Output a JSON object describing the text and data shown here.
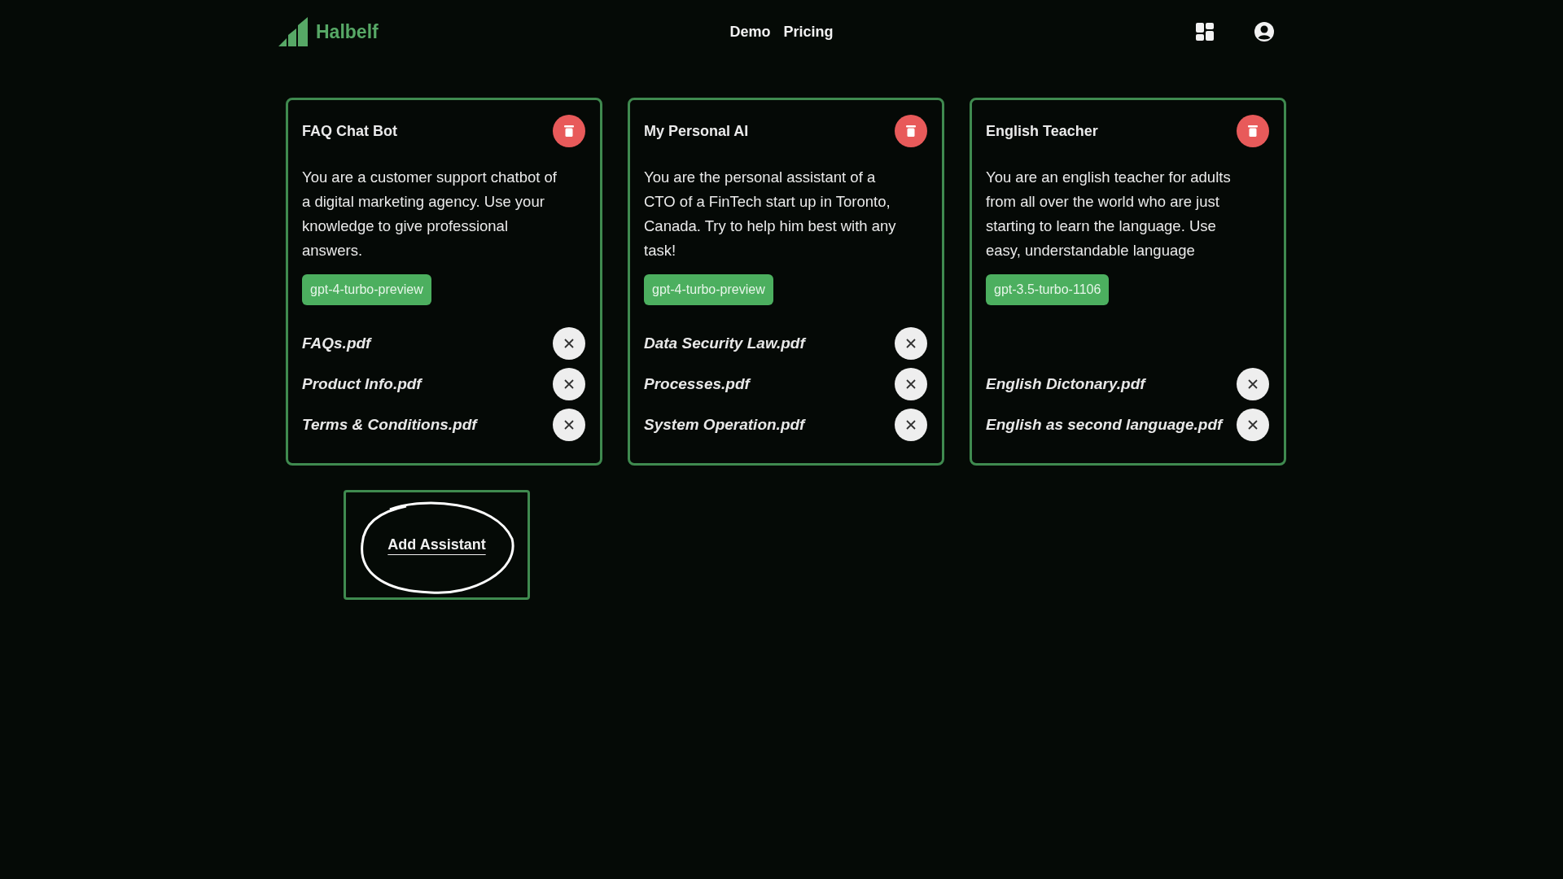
{
  "brand": {
    "name": "Halbelf"
  },
  "nav": [
    {
      "label": "Demo"
    },
    {
      "label": "Pricing"
    }
  ],
  "assistants": [
    {
      "title": "FAQ Chat Bot",
      "description": "You are a customer support chatbot of a digital marketing agency. Use your knowledge to give professional answers.",
      "model": "gpt-4-turbo-preview",
      "files": [
        "FAQs.pdf",
        "Product Info.pdf",
        "Terms & Conditions.pdf"
      ]
    },
    {
      "title": "My Personal AI",
      "description": "You are the personal assistant of a CTO of a FinTech start up in Toronto, Canada. Try to help him best with any task!",
      "model": "gpt-4-turbo-preview",
      "files": [
        "Data Security Law.pdf",
        "Processes.pdf",
        "System Operation.pdf"
      ]
    },
    {
      "title": "English Teacher",
      "description": "You are an english teacher for adults from all over the world who are just starting to learn the language. Use easy, understandable language",
      "model": "gpt-3.5-turbo-1106",
      "files": [
        "English Dictonary.pdf",
        "English as second language.pdf"
      ]
    }
  ],
  "add_button": {
    "label": "Add Assistant"
  }
}
